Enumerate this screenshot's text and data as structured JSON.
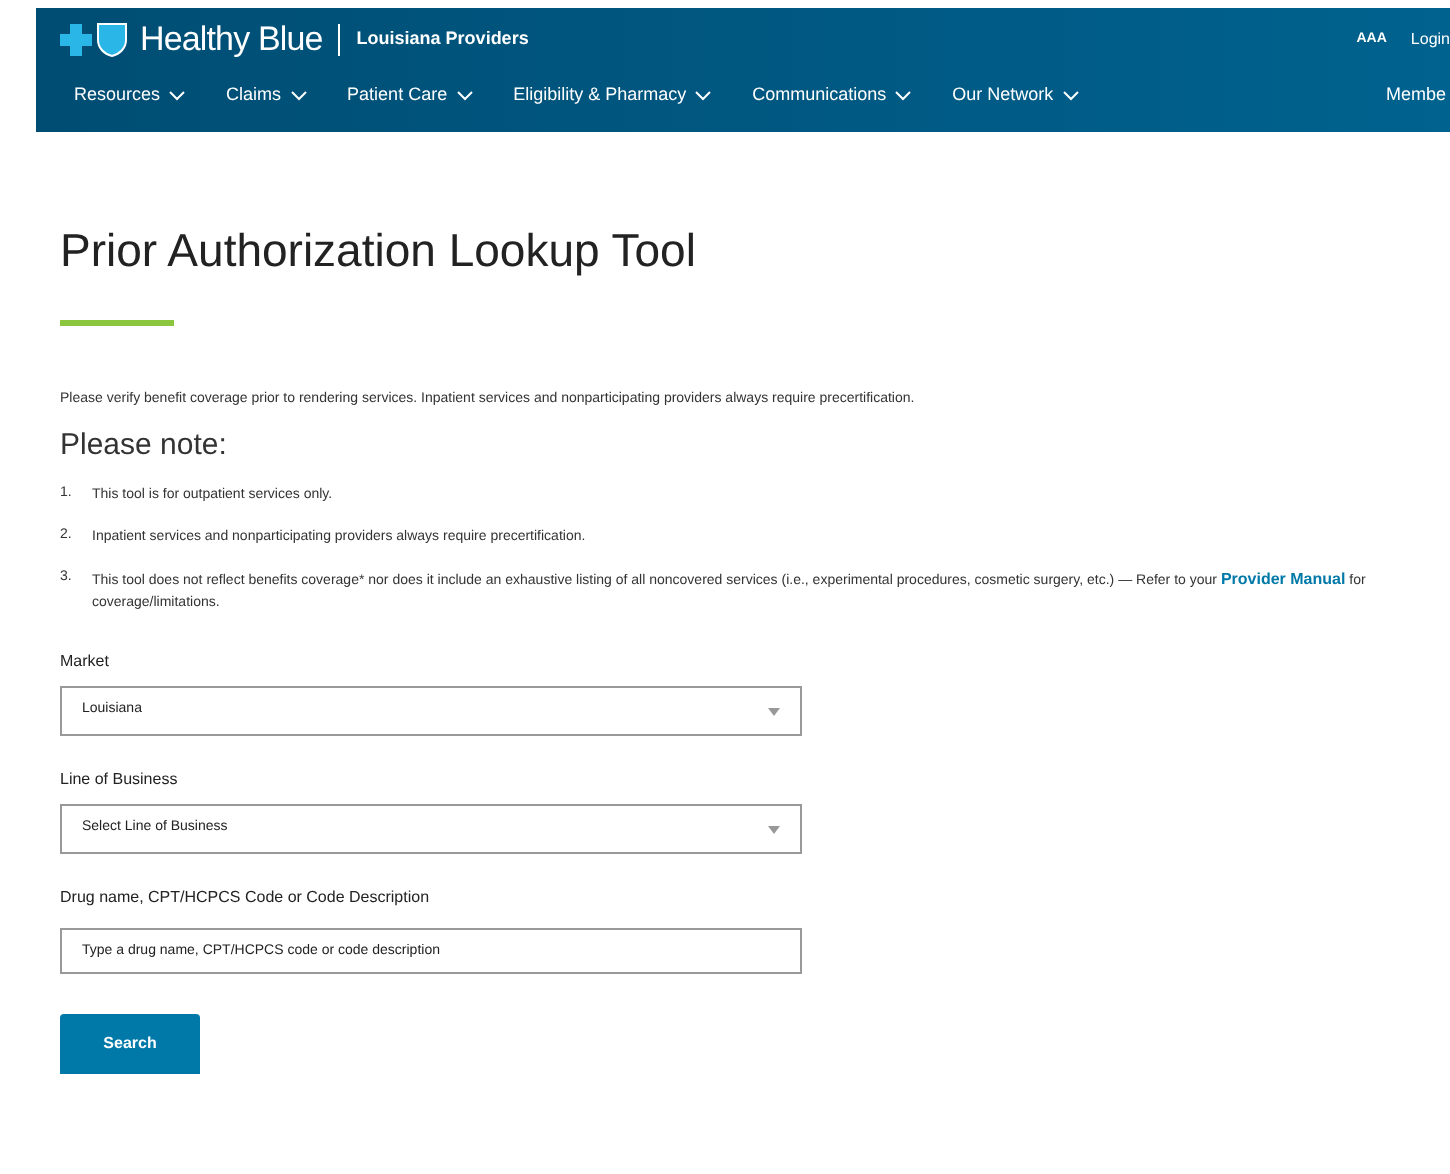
{
  "header": {
    "brand": "Healthy Blue",
    "subtitle": "Louisiana Providers",
    "text_size": "AAA",
    "login": "Login",
    "nav": [
      {
        "label": "Resources",
        "dropdown": true
      },
      {
        "label": "Claims",
        "dropdown": true
      },
      {
        "label": "Patient Care",
        "dropdown": true
      },
      {
        "label": "Eligibility & Pharmacy",
        "dropdown": true
      },
      {
        "label": "Communications",
        "dropdown": true
      },
      {
        "label": "Our Network",
        "dropdown": true
      },
      {
        "label": "Membe",
        "dropdown": false
      }
    ]
  },
  "page": {
    "title": "Prior Authorization Lookup Tool",
    "intro": "Please verify benefit coverage prior to rendering services. Inpatient services and nonparticipating providers always require precertification.",
    "note_heading": "Please note:",
    "notes": [
      {
        "number": "1.",
        "text": "This tool is for outpatient services only."
      },
      {
        "number": "2.",
        "text": "Inpatient services and nonparticipating providers always require precertification."
      },
      {
        "number": "3.",
        "text": "This tool does not reflect benefits coverage* nor does it include an exhaustive listing of all noncovered services (i.e., experimental procedures, cosmetic surgery, etc.) — Refer to your",
        "link": "Provider Manual",
        "after": "for coverage/limitations."
      }
    ]
  },
  "form": {
    "fields": [
      {
        "label": "Market",
        "kind": "select",
        "value": "Louisiana"
      },
      {
        "label": "Line of Business",
        "kind": "select",
        "value": "Select Line of Business"
      },
      {
        "label": "Drug name, CPT/HCPCS Code or Code Description",
        "kind": "text",
        "placeholder": "Type a drug name, CPT/HCPCS code or code description"
      }
    ],
    "submit": "Search"
  }
}
